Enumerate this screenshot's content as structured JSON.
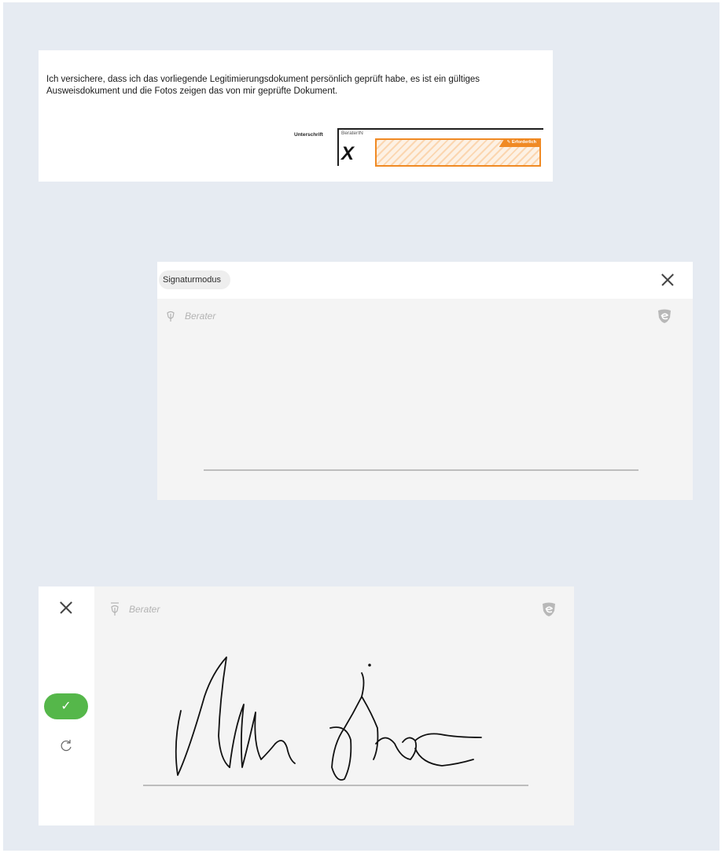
{
  "document": {
    "line1": "Ich versichere, dass ich das vorliegende Legitimierungsdokument persönlich geprüft habe, es ist ein gültiges",
    "line2": "Ausweisdokument und die Fotos zeigen das von mir geprüfte Dokument.",
    "signature_label": "Unterschrift",
    "field_label": "BeraterIN",
    "placeholder_mark": "X",
    "required_badge": "Erforderlich",
    "accent_color": "#f08a24"
  },
  "signature_mode_dialog": {
    "mode_label": "Signaturmodus",
    "signer_label": "Berater",
    "close_icon": "close-icon",
    "pen_icon": "fountain-pen-icon",
    "brand_icon": "shield-logo-icon"
  },
  "signed_dialog": {
    "signer_label": "Berater",
    "confirm_symbol": "✓",
    "confirm_color": "#55b74a",
    "reset_icon": "refresh-icon",
    "close_icon": "close-icon",
    "brand_icon": "shield-logo-icon"
  }
}
